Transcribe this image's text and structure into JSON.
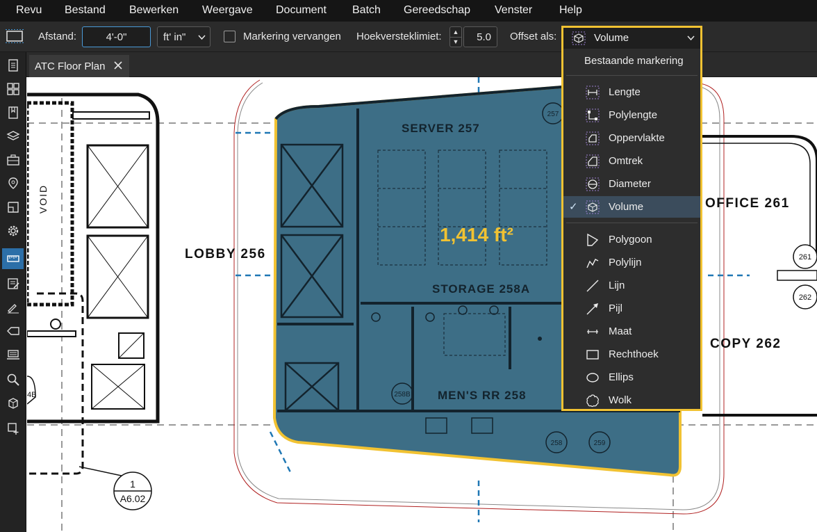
{
  "menu": [
    "Revu",
    "Bestand",
    "Bewerken",
    "Weergave",
    "Document",
    "Batch",
    "Gereedschap",
    "Venster",
    "Help"
  ],
  "toolbar": {
    "distance_label": "Afstand:",
    "distance_value": "4'-0\"",
    "unit_value": "ft' in\"",
    "replace_markup_label": "Markering vervangen",
    "corner_limit_label": "Hoekversteklimiet:",
    "corner_limit_value": "5.0",
    "offset_as_label": "Offset als:",
    "offset_as_value": "Volume"
  },
  "tab": {
    "title": "ATC Floor Plan"
  },
  "dropdown": {
    "header": "Bestaande markering",
    "group1": [
      {
        "label": "Lengte",
        "icon": "length-icon"
      },
      {
        "label": "Polylengte",
        "icon": "polylength-icon"
      },
      {
        "label": "Oppervlakte",
        "icon": "area-icon"
      },
      {
        "label": "Omtrek",
        "icon": "perimeter-icon"
      },
      {
        "label": "Diameter",
        "icon": "diameter-icon"
      },
      {
        "label": "Volume",
        "icon": "volume-icon",
        "selected": true
      }
    ],
    "group2": [
      {
        "label": "Polygoon",
        "icon": "polygon-icon"
      },
      {
        "label": "Polylijn",
        "icon": "polyline-icon"
      },
      {
        "label": "Lijn",
        "icon": "line-icon"
      },
      {
        "label": "Pijl",
        "icon": "arrow-icon"
      },
      {
        "label": "Maat",
        "icon": "dimension-icon"
      },
      {
        "label": "Rechthoek",
        "icon": "rectangle-icon"
      },
      {
        "label": "Ellips",
        "icon": "ellipse-icon"
      },
      {
        "label": "Wolk",
        "icon": "cloud-icon"
      }
    ]
  },
  "plan": {
    "server_label": "SERVER 257",
    "storage_label": "STORAGE 258A",
    "mens_label": "MEN'S RR 258",
    "lobby_label": "LOBBY 256",
    "office_label": "OFFICE 261",
    "copy_label": "COPY 262",
    "void_label": "VOID",
    "area_measure": "1,414 ft²",
    "tag_257": "257",
    "tag_258b": "258B",
    "tag_258": "258",
    "tag_259": "259",
    "tag_261": "261",
    "tag_262": "262",
    "tag_4b": "4B",
    "section_num": "1",
    "section_sheet": "A6.02"
  },
  "colors": {
    "highlight": "#f1c232",
    "selected_fill": "#3d6e86",
    "measure_text": "#f1c232",
    "active_tool": "#2c6fa8"
  }
}
